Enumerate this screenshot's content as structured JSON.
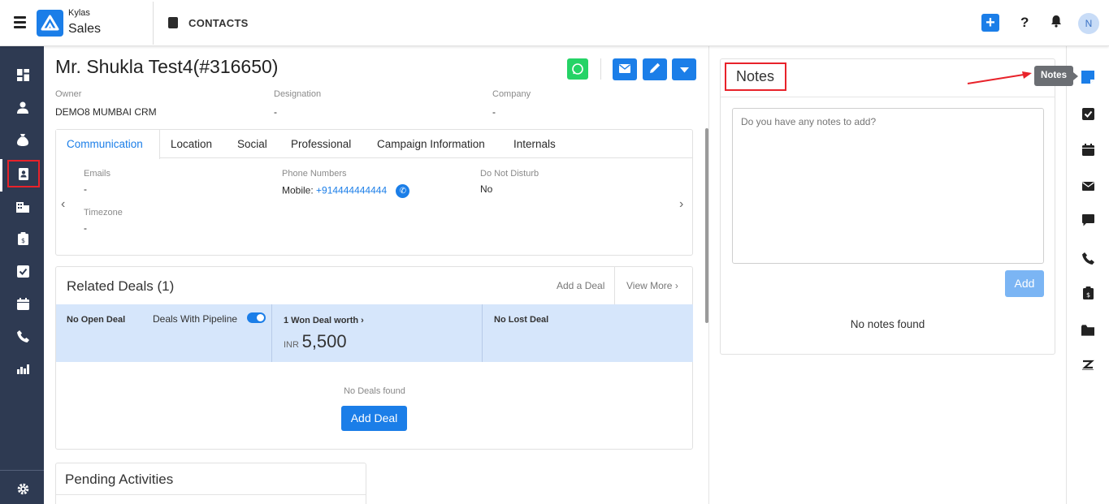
{
  "app": {
    "brand_top": "Kylas",
    "brand_bottom": "Sales",
    "module_title": "CONTACTS",
    "avatar_initial": "N"
  },
  "contact": {
    "title": "Mr. Shukla Test4(#316650)",
    "fields": [
      {
        "label": "Owner",
        "value": "DEMO8 MUMBAI CRM"
      },
      {
        "label": "Designation",
        "value": "-"
      },
      {
        "label": "Company",
        "value": "-"
      }
    ]
  },
  "tabs": [
    "Communication",
    "Location",
    "Social",
    "Professional",
    "Campaign Information",
    "Internals"
  ],
  "communication": {
    "emails_label": "Emails",
    "emails_value": "-",
    "phones_label": "Phone Numbers",
    "phone_prefix": "Mobile:",
    "phone_value": "+914444444444",
    "dnd_label": "Do Not Disturb",
    "dnd_value": "No",
    "timezone_label": "Timezone",
    "timezone_value": "-"
  },
  "deals": {
    "title": "Related Deals (1)",
    "add_link": "Add a Deal",
    "view_more": "View More",
    "open_label": "No Open Deal",
    "pipeline_label": "Deals With Pipeline",
    "pipeline_enabled": true,
    "won_label": "1 Won Deal worth",
    "currency": "INR",
    "won_amount": "5,500",
    "lost_label": "No Lost Deal",
    "empty_text": "No Deals found",
    "add_button": "Add Deal"
  },
  "activities": {
    "title": "Pending Activities"
  },
  "notes": {
    "title": "Notes",
    "placeholder": "Do you have any notes to add?",
    "add_button": "Add",
    "empty_text": "No notes found",
    "tooltip": "Notes"
  },
  "colors": {
    "accent": "#1b7ee8",
    "nav_bg": "#2e3a52",
    "highlight": "#e8222a",
    "whatsapp": "#25d366",
    "deal_strip": "#d6e6fb"
  }
}
